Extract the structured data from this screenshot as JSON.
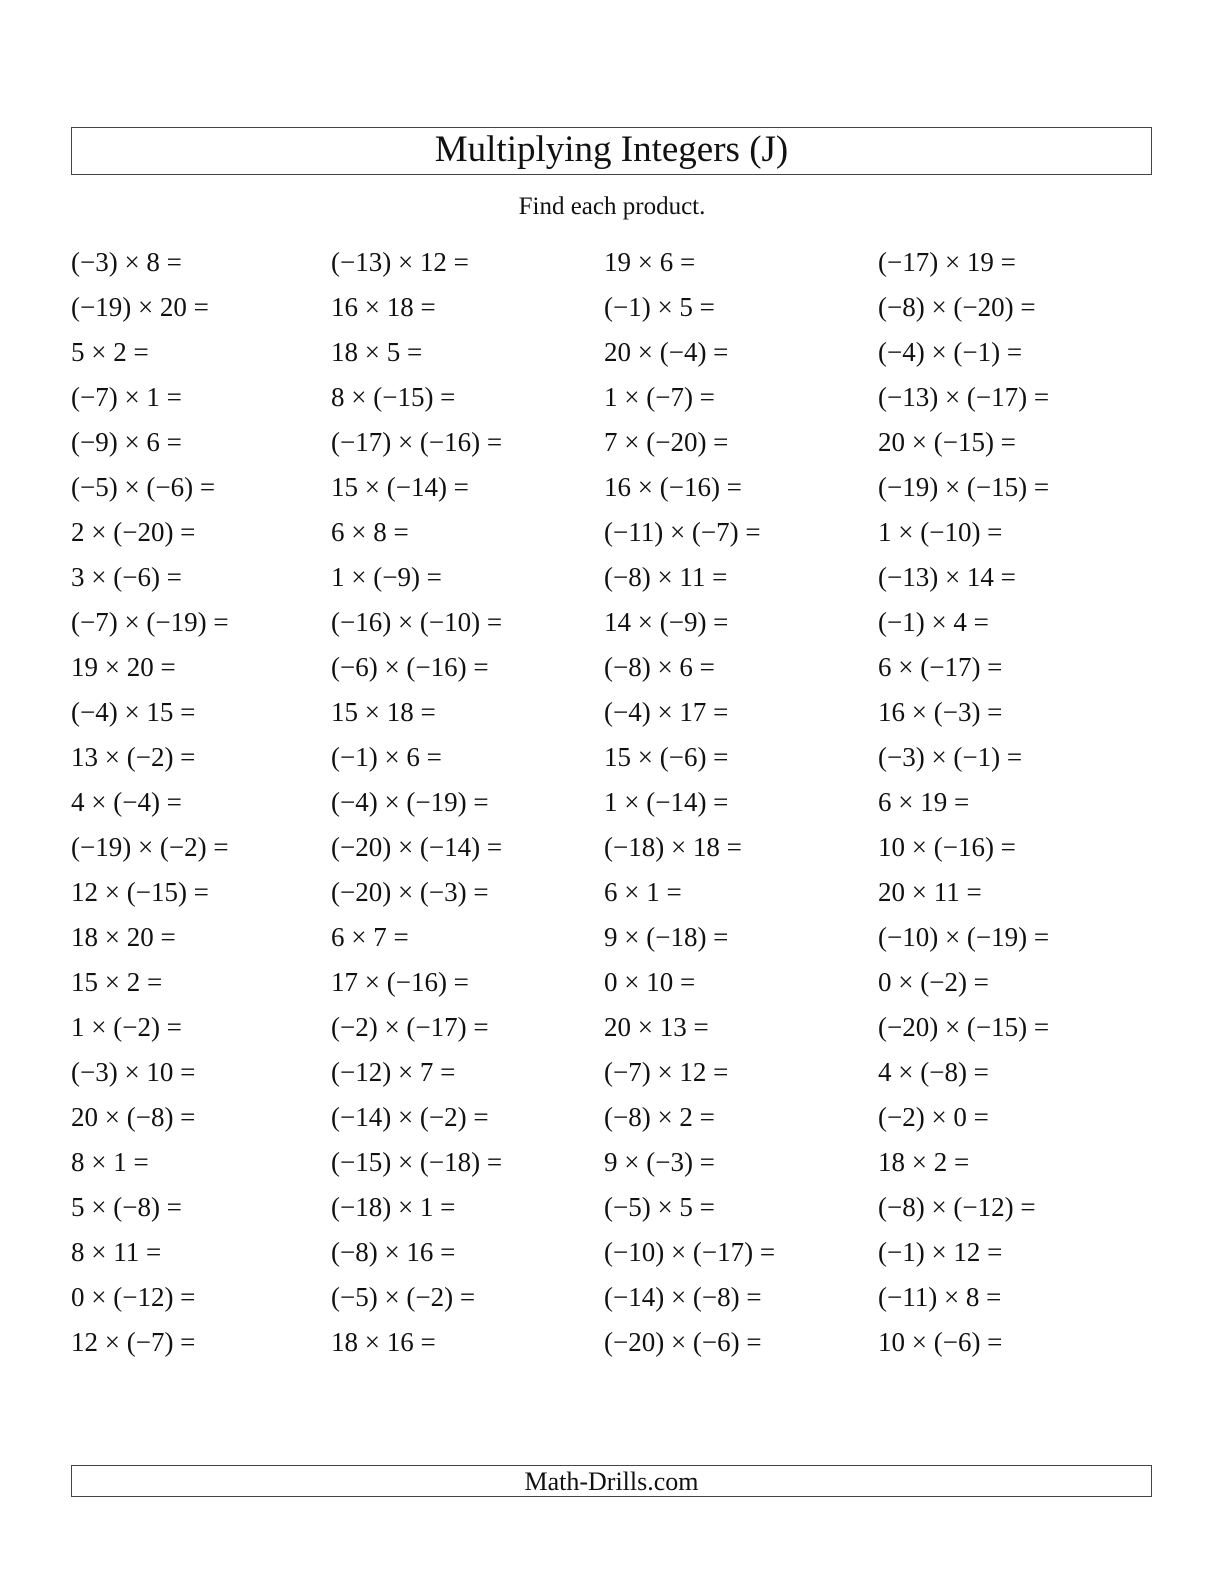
{
  "header": {
    "title": "Multiplying Integers (J)",
    "instructions": "Find each product."
  },
  "problems": [
    [
      "(−3) × 8 =",
      "(−13) × 12 =",
      "19 × 6 =",
      "(−17) × 19 ="
    ],
    [
      "(−19) × 20 =",
      "16 × 18 =",
      "(−1) × 5 =",
      "(−8) × (−20) ="
    ],
    [
      "5 × 2 =",
      "18 × 5 =",
      "20 × (−4) =",
      "(−4) × (−1) ="
    ],
    [
      "(−7) × 1 =",
      "8 × (−15) =",
      "1 × (−7) =",
      "(−13) × (−17) ="
    ],
    [
      "(−9) × 6 =",
      "(−17) × (−16) =",
      "7 × (−20) =",
      "20 × (−15) ="
    ],
    [
      "(−5) × (−6) =",
      "15 × (−14) =",
      "16 × (−16) =",
      "(−19) × (−15) ="
    ],
    [
      "2 × (−20) =",
      "6 × 8 =",
      "(−11) × (−7) =",
      "1 × (−10) ="
    ],
    [
      "3 × (−6) =",
      "1 × (−9) =",
      "(−8) × 11 =",
      "(−13) × 14 ="
    ],
    [
      "(−7) × (−19) =",
      "(−16) × (−10) =",
      "14 × (−9) =",
      "(−1) × 4 ="
    ],
    [
      "19 × 20 =",
      "(−6) × (−16) =",
      "(−8) × 6 =",
      "6 × (−17) ="
    ],
    [
      "(−4) × 15 =",
      "15 × 18 =",
      "(−4) × 17 =",
      "16 × (−3) ="
    ],
    [
      "13 × (−2) =",
      "(−1) × 6 =",
      "15 × (−6) =",
      "(−3) × (−1) ="
    ],
    [
      "4 × (−4) =",
      "(−4) × (−19) =",
      "1 × (−14) =",
      "6 × 19 ="
    ],
    [
      "(−19) × (−2) =",
      "(−20) × (−14) =",
      "(−18) × 18 =",
      "10 × (−16) ="
    ],
    [
      "12 × (−15) =",
      "(−20) × (−3) =",
      "6 × 1 =",
      "20 × 11 ="
    ],
    [
      "18 × 20 =",
      "6 × 7 =",
      "9 × (−18) =",
      "(−10) × (−19) ="
    ],
    [
      "15 × 2 =",
      "17 × (−16) =",
      "0 × 10 =",
      "0 × (−2) ="
    ],
    [
      "1 × (−2) =",
      "(−2) × (−17) =",
      "20 × 13 =",
      "(−20) × (−15) ="
    ],
    [
      "(−3) × 10 =",
      "(−12) × 7 =",
      "(−7) × 12 =",
      "4 × (−8) ="
    ],
    [
      "20 × (−8) =",
      "(−14) × (−2) =",
      "(−8) × 2 =",
      "(−2) × 0 ="
    ],
    [
      "8 × 1 =",
      "(−15) × (−18) =",
      "9 × (−3) =",
      "18 × 2 ="
    ],
    [
      "5 × (−8) =",
      "(−18) × 1 =",
      "(−5) × 5 =",
      "(−8) × (−12) ="
    ],
    [
      "8 × 11 =",
      "(−8) × 16 =",
      "(−10) × (−17) =",
      "(−1) × 12 ="
    ],
    [
      "0 × (−12) =",
      "(−5) × (−2) =",
      "(−14) × (−8) =",
      "(−11) × 8 ="
    ],
    [
      "12 × (−7) =",
      "18 × 16 =",
      "(−20) × (−6) =",
      "10 × (−6) ="
    ]
  ],
  "footer": {
    "text": "Math-Drills.com"
  }
}
